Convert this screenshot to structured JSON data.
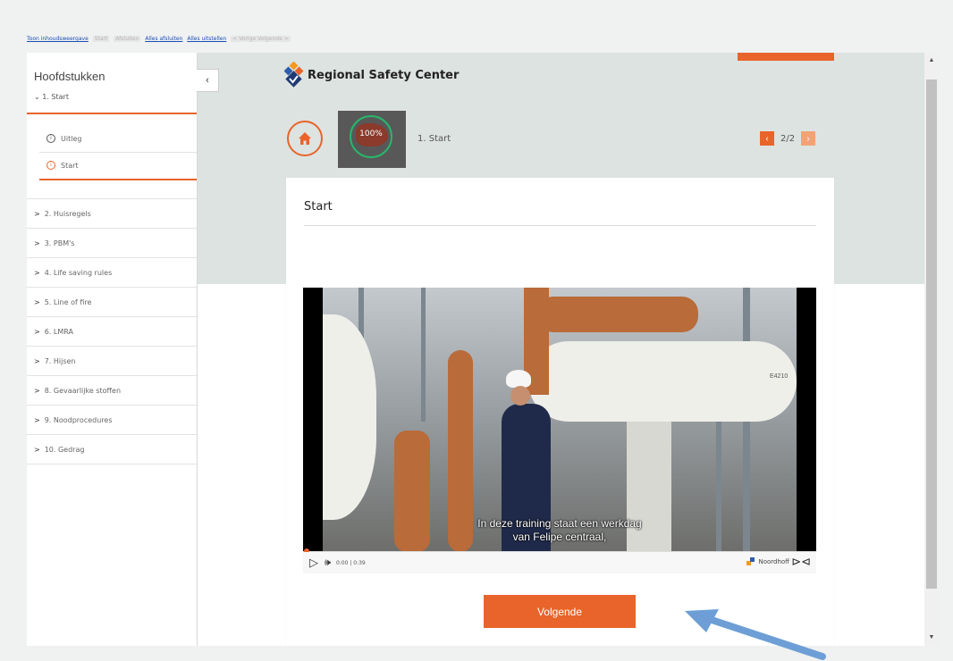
{
  "topbar": {
    "toc_link": "Toon inhoudsweergave",
    "start": "Start",
    "afsluiten": "Afsluiten",
    "alles_afsluiten": "Alles afsluiten",
    "alles_uitstellen": "Alles uitstellen",
    "nav": "< Vorige  Volgende >"
  },
  "sidebar": {
    "title": "Hoofdstukken",
    "current_chapter": "1. Start",
    "sub_items": [
      {
        "label": "Uitleg"
      },
      {
        "label": "Start"
      }
    ],
    "chapters": [
      "2. Huisregels",
      "3. PBM's",
      "4. Life saving rules",
      "5. Line of fire",
      "6. LMRA",
      "7. Hijsen",
      "8. Gevaarlijke stoffen",
      "9. Noodprocedures",
      "10. Gedrag"
    ]
  },
  "header": {
    "logo_text": "Regional Safety Center",
    "chapter_progress": "100%",
    "chapter_label": "1. Start",
    "pager": "2/2"
  },
  "content": {
    "title": "Start",
    "video": {
      "subtitle_line1": "In deze training staat een werkdag",
      "subtitle_line2": "van Felipe centraal,",
      "time": "0:00 | 0:39",
      "brand": "Noordhoff",
      "tank_label": "E4210"
    },
    "next_button": "Volgende"
  },
  "colors": {
    "accent": "#e8642b",
    "banner": "#dde3e0",
    "progress_ring": "#27b76b",
    "annotation_arrow": "#6d9fd6"
  }
}
